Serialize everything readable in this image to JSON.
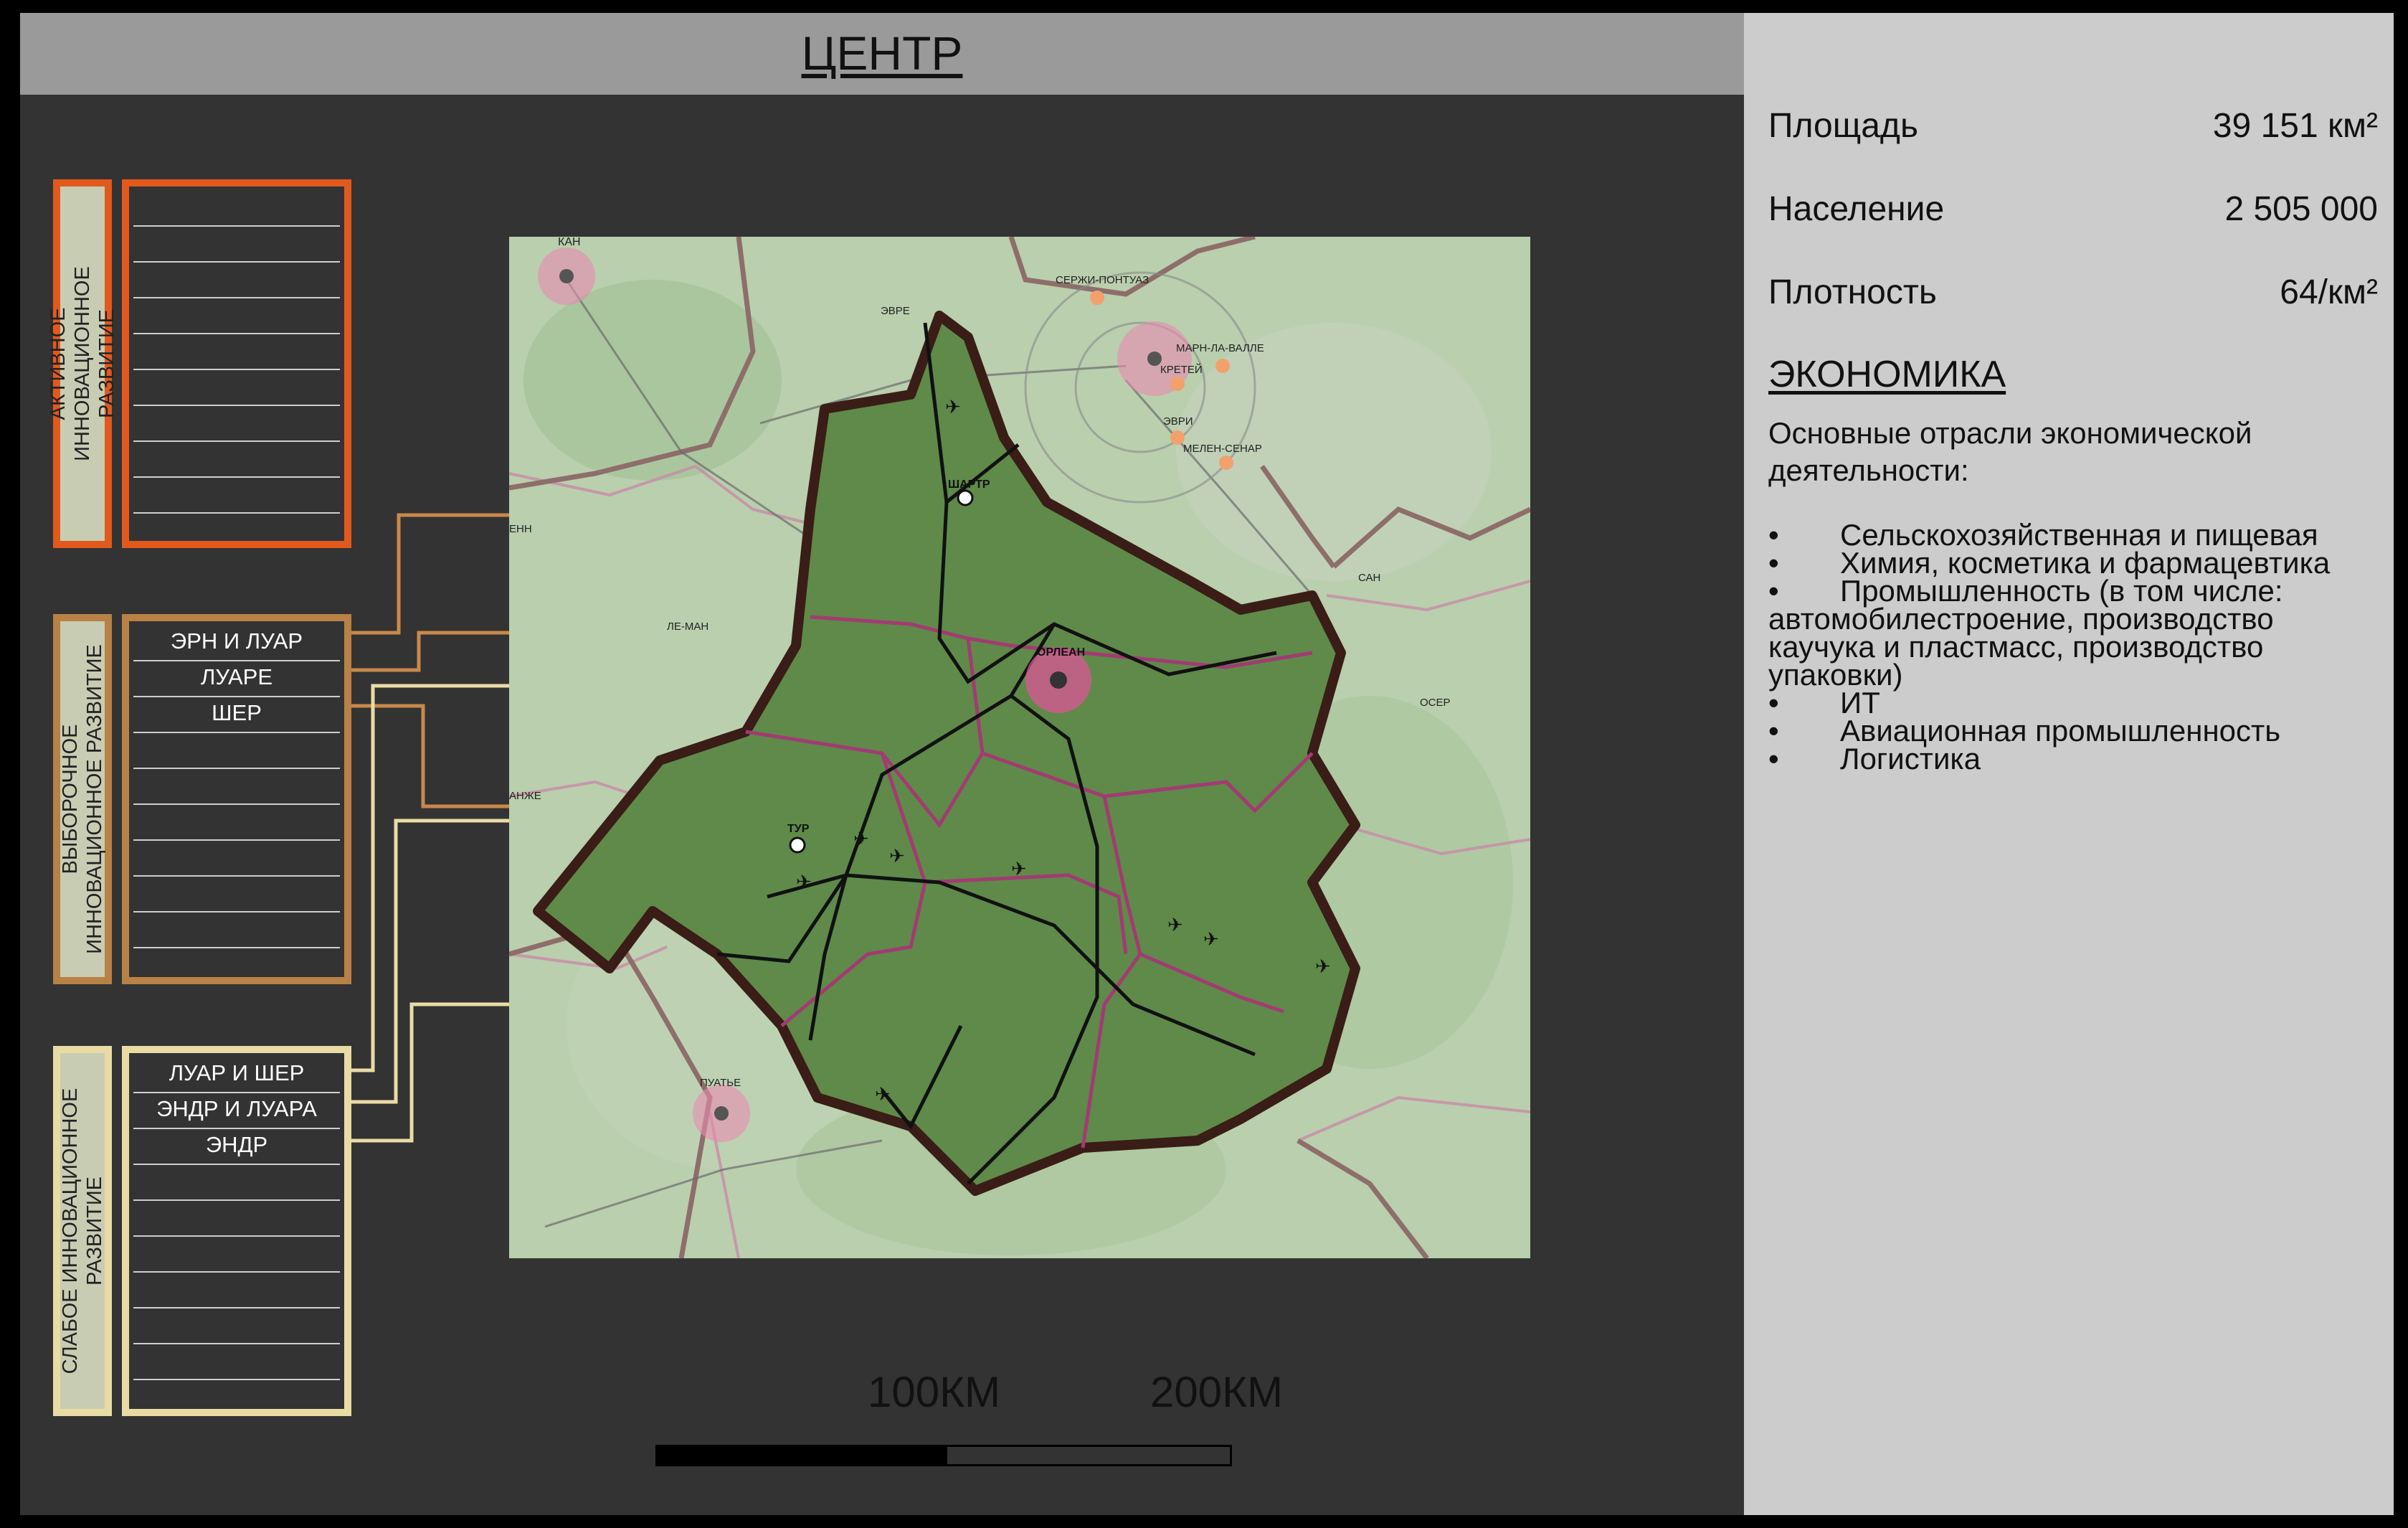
{
  "title": "ЦЕНТР",
  "stats": [
    {
      "label": "Площадь",
      "value": "39 151 км²"
    },
    {
      "label": "Население",
      "value": "2 505 000"
    },
    {
      "label": "Плотность",
      "value": "64/км²"
    }
  ],
  "economy": {
    "heading": "ЭКОНОМИКА",
    "intro": "Основные отрасли экономической деятельности:",
    "items": [
      "Сельскохозяйственная и пищевая",
      "Химия, косметика и фармацевтика",
      "Промышленность (в том числе: автомобилестроение, производство каучука и пластмасс, производство упаковки)",
      "ИТ",
      "Авиационная промышленность",
      "Логистика"
    ],
    "bullet": "•"
  },
  "categories": [
    {
      "name": "АКТИВНОЕ ИННОВАЦИОННОЕ РАЗВИТИЕ",
      "color": "#e2591d",
      "regions": []
    },
    {
      "name": "ВЫБОРОЧНОЕ ИННОВАЦИОННОЕ РАЗВИТИЕ",
      "color": "#b88146",
      "regions": [
        "ЭРН И ЛУАР",
        "ЛУАРЕ",
        "ШЕР"
      ]
    },
    {
      "name": "СЛАБОЕ ИННОВАЦИОННОЕ РАЗВИТИЕ",
      "color": "#e8dca4",
      "regions": [
        "ЛУАР И ШЕР",
        "ЭНДР И ЛУАРА",
        "ЭНДР"
      ]
    }
  ],
  "map": {
    "cities": [
      "КАН",
      "ЭВРЕ",
      "СЕРЖИ-ПОНТУАЗ",
      "МАРН-ЛА-ВАЛЛЕ",
      "КРЕТЕЙ",
      "ЭВРИ",
      "МЕЛЕН-СЕНАР",
      "ШАРТР",
      "ЛЕ-МАН",
      "ОРЛЕАН",
      "САН",
      "ОСЕР",
      "АНЖЕ",
      "ТУР",
      "ПУАТЬЕ",
      "ЕНН"
    ],
    "colors": {
      "region_border": "#3a1d17",
      "department_border": "#a23b72",
      "map_base": "#b9cfae",
      "region_fill": "#5f8a4a"
    }
  },
  "scale": {
    "label_1": "100КМ",
    "label_2": "200КМ"
  }
}
